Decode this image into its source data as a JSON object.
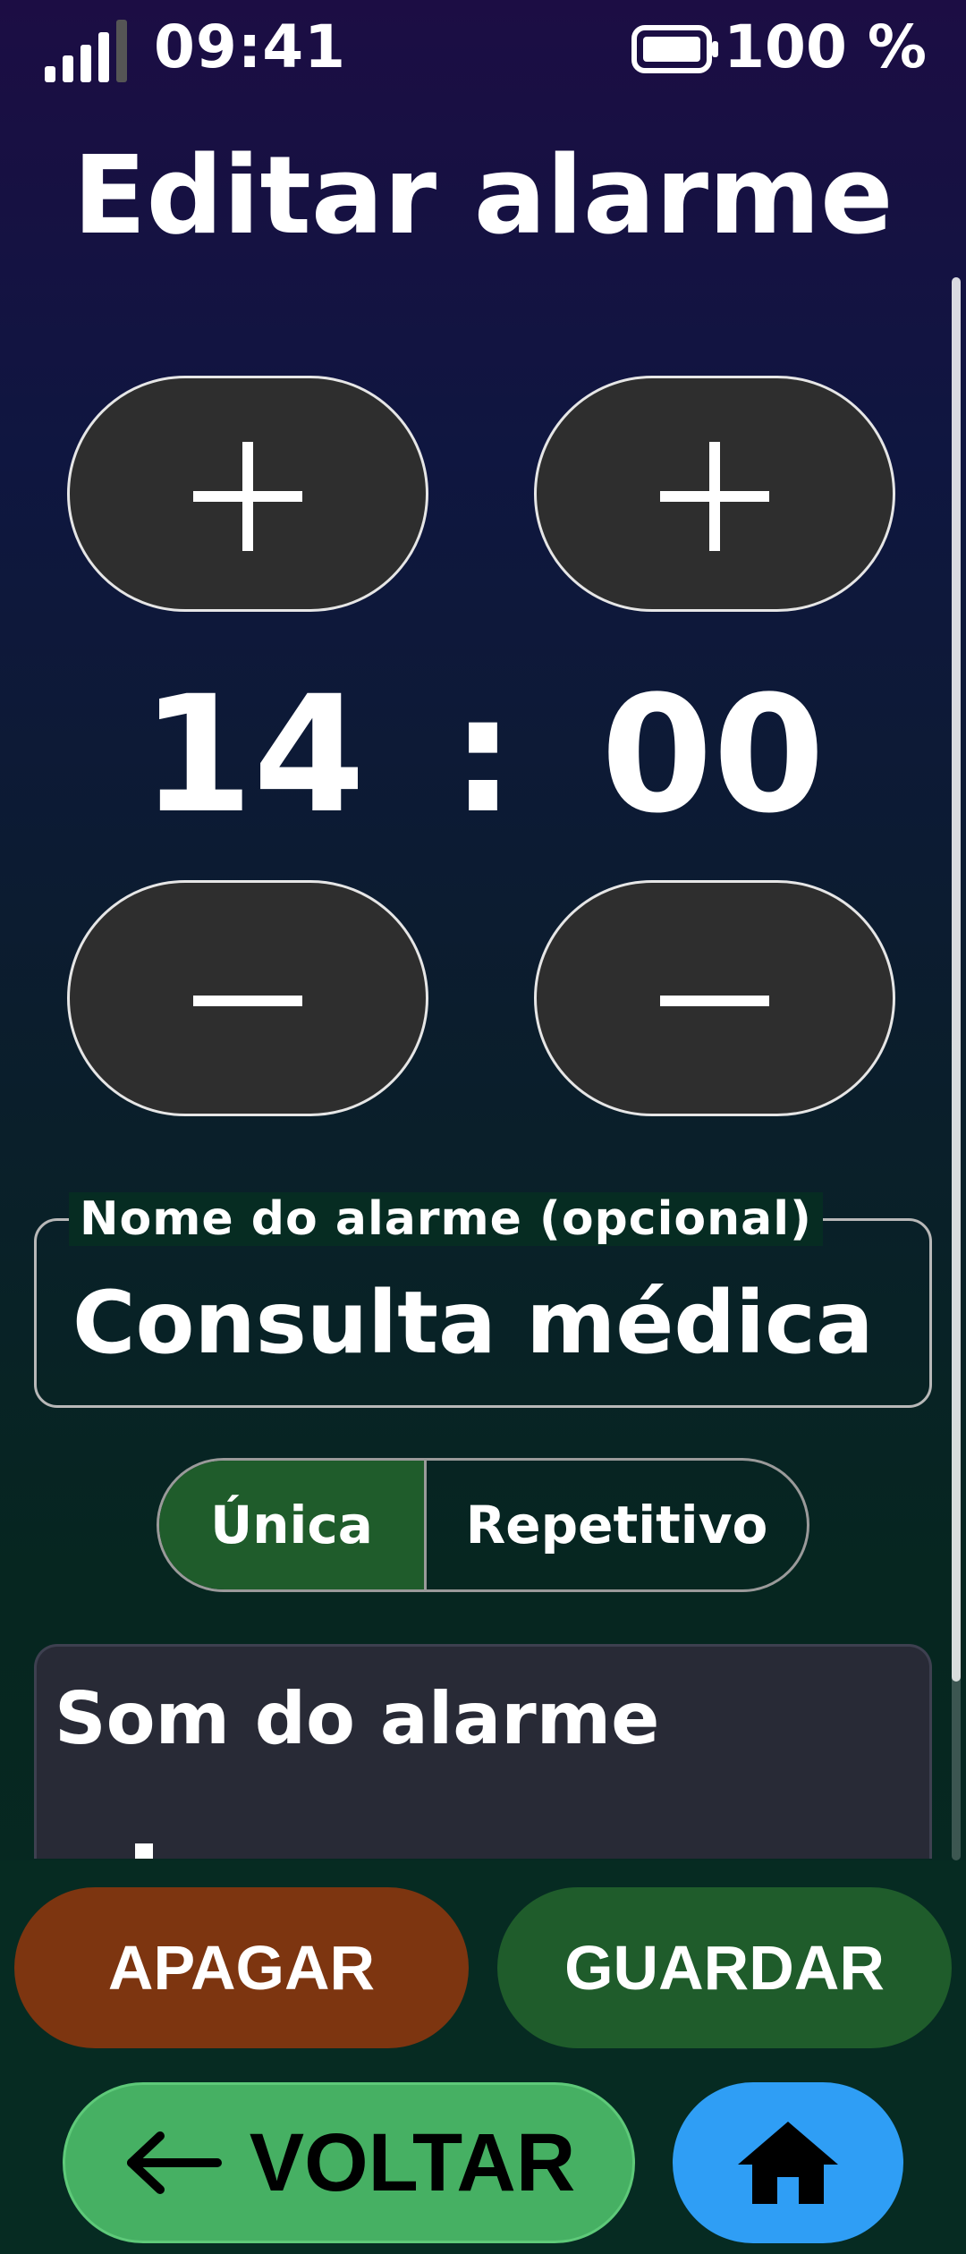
{
  "status": {
    "time": "09:41",
    "battery": "100 %",
    "signal_icon": "signal-bars-icon",
    "battery_icon": "battery-full-icon"
  },
  "title": "Editar alarme",
  "time_picker": {
    "hours": "14",
    "separator": ":",
    "minutes": "00"
  },
  "name_field": {
    "label": "Nome do alarme (opcional)",
    "value": "Consulta médica"
  },
  "mode": {
    "options": [
      "Única",
      "Repetitivo"
    ],
    "selected": "Única"
  },
  "sound": {
    "title": "Som do alarme"
  },
  "actions": {
    "delete": "APAGAR",
    "save": "GUARDAR",
    "back": "VOLTAR",
    "home_icon": "home-icon"
  },
  "colors": {
    "delete": "#7d3510",
    "save": "#1f5c2b",
    "back": "#46b063",
    "home": "#2f9ef5",
    "selected_segment": "#1f5c2b"
  }
}
